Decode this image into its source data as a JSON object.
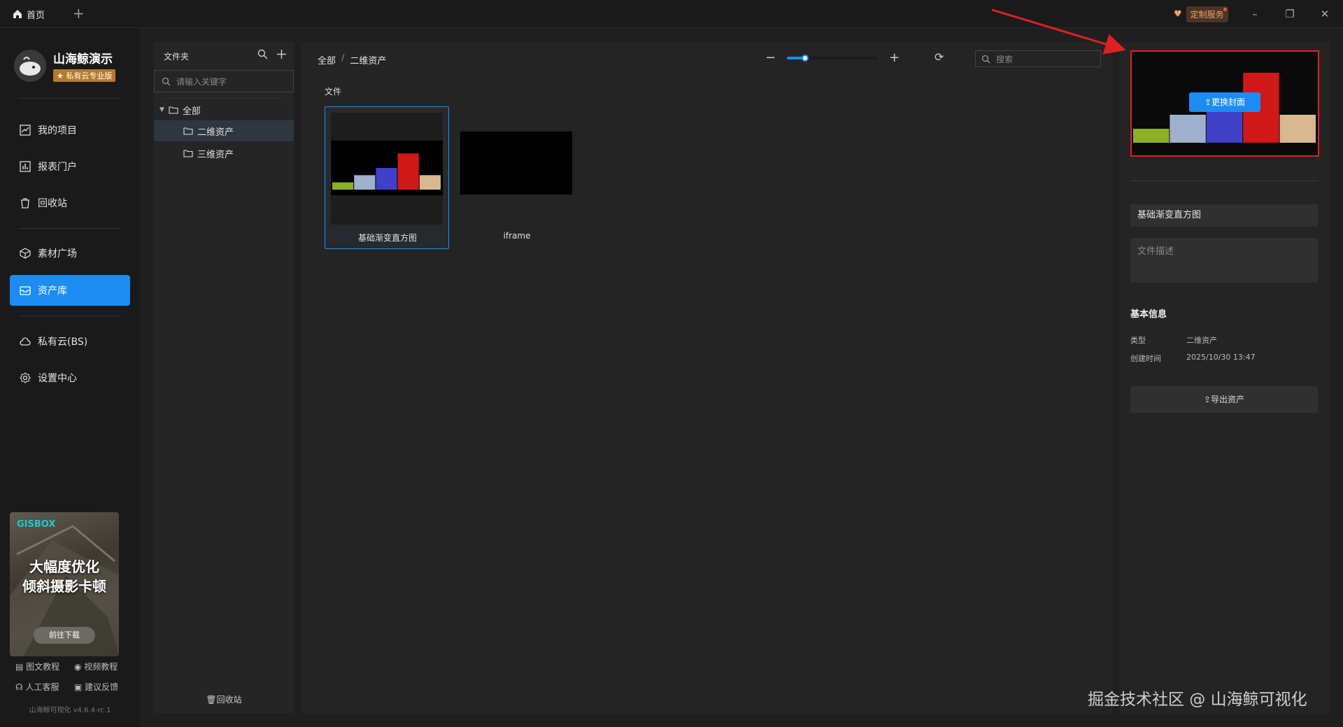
{
  "titlebar": {
    "home_tab": "首页",
    "service_badge": "定制服务"
  },
  "sidebar": {
    "brand_name": "山海鲸演示",
    "brand_badge": "★ 私有云专业版",
    "items": [
      {
        "label": "我的项目",
        "icon": "chart-icon"
      },
      {
        "label": "报表门户",
        "icon": "report-icon"
      },
      {
        "label": "回收站",
        "icon": "trash-icon"
      },
      {
        "label": "素材广场",
        "icon": "cube-icon"
      },
      {
        "label": "资产库",
        "icon": "box-icon"
      },
      {
        "label": "私有云(BS)",
        "icon": "cloud-icon"
      },
      {
        "label": "设置中心",
        "icon": "gear-icon"
      }
    ],
    "promo": {
      "logo": "GISBOX",
      "title_line1": "大幅度优化",
      "title_line2": "倾斜摄影卡顿",
      "button": "前往下载"
    },
    "helpers": [
      "图文教程",
      "视频教程",
      "人工客服",
      "建议反馈"
    ],
    "version": "山海鲸可视化 v4.6.4-rc.1"
  },
  "folder_panel": {
    "title": "文件夹",
    "search_placeholder": "请输入关键字",
    "tree": [
      "全部",
      "二维资产",
      "三维资产"
    ],
    "recycle": "回收站"
  },
  "main": {
    "breadcrumb_root": "全部",
    "breadcrumb_sep": "/",
    "breadcrumb_current": "二维资产",
    "zoom_level": 0.2,
    "search_placeholder": "搜索",
    "section_label": "文件",
    "cards": [
      {
        "label": "基础渐变直方图",
        "selected": true
      },
      {
        "label": "iframe",
        "selected": false
      }
    ]
  },
  "right_panel": {
    "change_cover": "更换封面",
    "name": "基础渐变直方图",
    "desc_placeholder": "文件描述",
    "info_title": "基本信息",
    "type_key": "类型",
    "type_value": "二维资产",
    "created_key": "创建时间",
    "created_value": "2025/10/30 13:47",
    "export": "导出资产"
  },
  "watermark": "掘金技术社区 @ 山海鲸可视化",
  "chart_data": {
    "type": "bar",
    "values": [
      1,
      2,
      3,
      5,
      2
    ],
    "colors": [
      "#8db02a",
      "#9fb0cc",
      "#4040c8",
      "#d01818",
      "#d8b890"
    ]
  }
}
